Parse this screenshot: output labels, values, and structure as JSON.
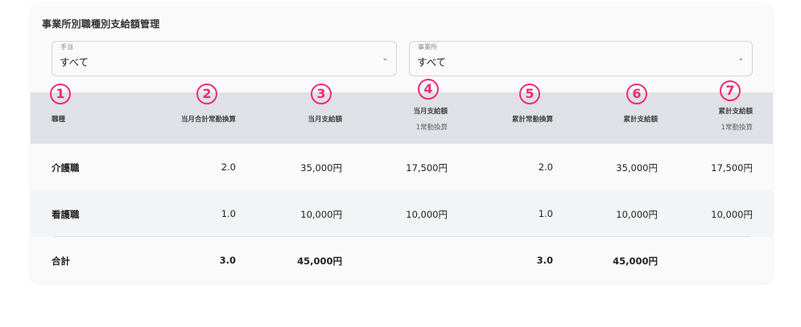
{
  "title": "事業所別職種別支給額管理",
  "filters": [
    {
      "label": "手当",
      "value": "すべて"
    },
    {
      "label": "事業所",
      "value": "すべて"
    }
  ],
  "annotations": [
    "1",
    "2",
    "3",
    "4",
    "5",
    "6",
    "7"
  ],
  "table": {
    "headers": [
      {
        "label": "職種",
        "sub": ""
      },
      {
        "label": "当月合計常勤換算",
        "sub": ""
      },
      {
        "label": "当月支給額",
        "sub": ""
      },
      {
        "label": "当月支給額",
        "sub": "1常勤換算"
      },
      {
        "label": "累計常勤換算",
        "sub": ""
      },
      {
        "label": "累計支給額",
        "sub": ""
      },
      {
        "label": "累計支給額",
        "sub": "1常勤換算"
      }
    ],
    "rows": [
      [
        "介護職",
        "2.0",
        "35,000円",
        "17,500円",
        "2.0",
        "35,000円",
        "17,500円"
      ],
      [
        "看護職",
        "1.0",
        "10,000円",
        "10,000円",
        "1.0",
        "10,000円",
        "10,000円"
      ]
    ],
    "total": [
      "合計",
      "3.0",
      "45,000円",
      "",
      "3.0",
      "45,000円",
      ""
    ]
  },
  "colors": {
    "annotation": "#ee2d73",
    "header_bg": "#dfe1e6",
    "card_bg": "#fafafa"
  }
}
